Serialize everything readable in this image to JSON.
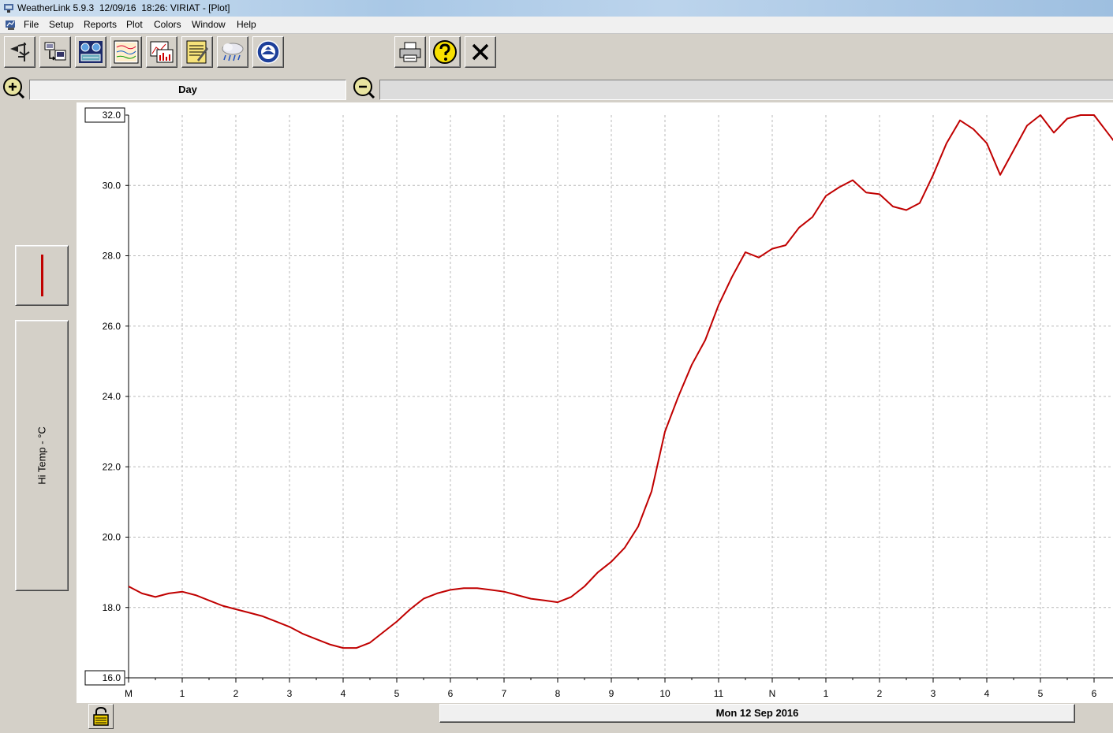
{
  "window": {
    "title": "WeatherLink 5.9.3  12/09/16  18:26: VIRIAT - [Plot]"
  },
  "menu": {
    "items": [
      "File",
      "Setup",
      "Reports",
      "Plot",
      "Colors",
      "Window",
      "Help"
    ]
  },
  "toolbar": {
    "buttons": [
      "bulletin-icon",
      "download-icon",
      "summary-icon",
      "strip-chart-icon",
      "plot-icon",
      "browse-icon",
      "rain-cloud-icon",
      "noaa-icon",
      "print-icon",
      "help-icon",
      "close-icon"
    ]
  },
  "zoom": {
    "in_icon": "zoom-in-icon",
    "out_icon": "zoom-out-icon",
    "span_label": "Day"
  },
  "legend": {
    "series_color": "#c00000",
    "axis_label": "Hi Temp - °C"
  },
  "footer": {
    "date_label": "Mon 12 Sep 2016",
    "lock_icon": "padlock-icon"
  },
  "chart_data": {
    "type": "line",
    "ylabel": "Hi Temp - °C",
    "ylim": [
      16.0,
      32.0
    ],
    "y_ticks": [
      "32.0",
      "30.0",
      "28.0",
      "26.0",
      "24.0",
      "22.0",
      "20.0",
      "18.0",
      "16.0"
    ],
    "x_tick_labels": [
      "M",
      "1",
      "2",
      "3",
      "4",
      "5",
      "6",
      "7",
      "8",
      "9",
      "10",
      "11",
      "N",
      "1",
      "2",
      "3",
      "4",
      "5",
      "6"
    ],
    "xlim": [
      0,
      18.4
    ],
    "grid": true,
    "line_color": "#c00000",
    "series": [
      {
        "x": [
          0,
          0.25,
          0.5,
          0.75,
          1,
          1.25,
          1.5,
          1.75,
          2,
          2.25,
          2.5,
          2.75,
          3,
          3.25,
          3.5,
          3.75,
          4,
          4.25,
          4.5,
          4.75,
          5,
          5.25,
          5.5,
          5.75,
          6,
          6.25,
          6.5,
          6.75,
          7,
          7.25,
          7.5,
          7.75,
          8,
          8.25,
          8.5,
          8.75,
          9,
          9.25,
          9.5,
          9.75,
          10,
          10.25,
          10.5,
          10.75,
          11,
          11.25,
          11.5,
          11.75,
          12,
          12.25,
          12.5,
          12.75,
          13,
          13.25,
          13.5,
          13.75,
          14,
          14.25,
          14.5,
          14.75,
          15,
          15.25,
          15.5,
          15.75,
          16,
          16.25,
          16.5,
          16.75,
          17,
          17.25,
          17.5,
          17.75,
          18,
          18.25,
          18.4
        ],
        "values": [
          18.6,
          18.4,
          18.3,
          18.4,
          18.45,
          18.35,
          18.2,
          18.05,
          17.95,
          17.85,
          17.75,
          17.6,
          17.45,
          17.25,
          17.1,
          16.95,
          16.85,
          16.85,
          17.0,
          17.3,
          17.6,
          17.95,
          18.25,
          18.4,
          18.5,
          18.55,
          18.55,
          18.5,
          18.45,
          18.35,
          18.25,
          18.2,
          18.15,
          18.3,
          18.6,
          19.0,
          19.3,
          19.7,
          20.3,
          21.3,
          23.0,
          24.0,
          24.9,
          25.6,
          26.6,
          27.4,
          28.1,
          27.95,
          28.2,
          28.3,
          28.8,
          29.1,
          29.7,
          29.95,
          30.15,
          29.8,
          29.75,
          29.4,
          29.3,
          29.5,
          30.3,
          31.2,
          31.85,
          31.6,
          31.2,
          30.3,
          31.0,
          31.7,
          32.0,
          31.5,
          31.9,
          32.0,
          32.0,
          31.5,
          31.2
        ]
      }
    ]
  }
}
